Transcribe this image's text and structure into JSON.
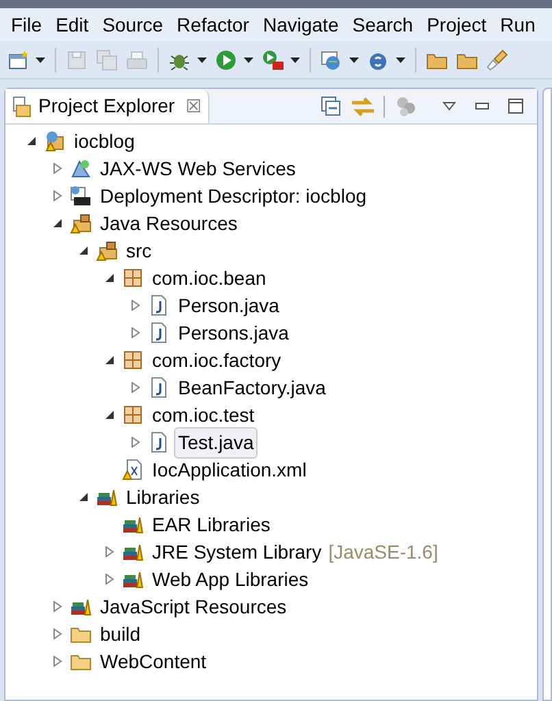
{
  "menu": [
    "File",
    "Edit",
    "Source",
    "Refactor",
    "Navigate",
    "Search",
    "Project",
    "Run"
  ],
  "toolbar": [
    {
      "kind": "new",
      "dropdown": true,
      "disabled": false
    },
    {
      "kind": "save",
      "dropdown": false,
      "disabled": true
    },
    {
      "kind": "save-all",
      "dropdown": false,
      "disabled": true
    },
    {
      "kind": "print",
      "dropdown": false,
      "disabled": true
    },
    {
      "kind": "debug",
      "dropdown": true,
      "disabled": false
    },
    {
      "kind": "run",
      "dropdown": true,
      "disabled": false
    },
    {
      "kind": "run-server",
      "dropdown": true,
      "disabled": false
    },
    {
      "kind": "globe",
      "dropdown": true,
      "disabled": false
    },
    {
      "kind": "service",
      "dropdown": true,
      "disabled": false
    },
    {
      "kind": "open-folder",
      "dropdown": false,
      "disabled": false
    },
    {
      "kind": "open-folder",
      "dropdown": false,
      "disabled": false
    },
    {
      "kind": "brush",
      "dropdown": false,
      "disabled": false
    }
  ],
  "view": {
    "title": "Project Explorer",
    "close": "☒"
  },
  "tree": [
    {
      "label": "iocblog",
      "kind": "project",
      "expanded": true,
      "selected": false,
      "children": [
        {
          "label": "JAX-WS Web Services",
          "kind": "webservice",
          "expanded": false,
          "selected": false
        },
        {
          "label": "Deployment Descriptor: iocblog",
          "kind": "descriptor",
          "expanded": false,
          "selected": false
        },
        {
          "label": "Java Resources",
          "kind": "source-folder",
          "expanded": true,
          "selected": false,
          "children": [
            {
              "label": "src",
              "kind": "source-folder",
              "expanded": true,
              "selected": false,
              "children": [
                {
                  "label": "com.ioc.bean",
                  "kind": "package",
                  "expanded": true,
                  "selected": false,
                  "children": [
                    {
                      "label": "Person.java",
                      "kind": "java",
                      "expanded": false,
                      "selected": false
                    },
                    {
                      "label": "Persons.java",
                      "kind": "java",
                      "expanded": false,
                      "selected": false
                    }
                  ]
                },
                {
                  "label": "com.ioc.factory",
                  "kind": "package",
                  "expanded": true,
                  "selected": false,
                  "children": [
                    {
                      "label": "BeanFactory.java",
                      "kind": "java",
                      "expanded": false,
                      "selected": false
                    }
                  ]
                },
                {
                  "label": "com.ioc.test",
                  "kind": "package",
                  "expanded": true,
                  "selected": false,
                  "children": [
                    {
                      "label": "Test.java",
                      "kind": "java",
                      "expanded": false,
                      "selected": true
                    }
                  ]
                },
                {
                  "label": "IocApplication.xml",
                  "kind": "xml",
                  "selected": false
                }
              ]
            },
            {
              "label": "Libraries",
              "kind": "library",
              "expanded": true,
              "selected": false,
              "children": [
                {
                  "label": "EAR Libraries",
                  "kind": "library",
                  "selected": false
                },
                {
                  "label": "JRE System Library",
                  "suffix": "[JavaSE-1.6]",
                  "kind": "library",
                  "expanded": false,
                  "selected": false
                },
                {
                  "label": "Web App Libraries",
                  "kind": "library",
                  "expanded": false,
                  "selected": false
                }
              ]
            }
          ]
        },
        {
          "label": "JavaScript Resources",
          "kind": "library",
          "expanded": false,
          "selected": false
        },
        {
          "label": "build",
          "kind": "folder",
          "expanded": false,
          "selected": false
        },
        {
          "label": "WebContent",
          "kind": "folder",
          "expanded": false,
          "selected": false
        }
      ]
    }
  ]
}
